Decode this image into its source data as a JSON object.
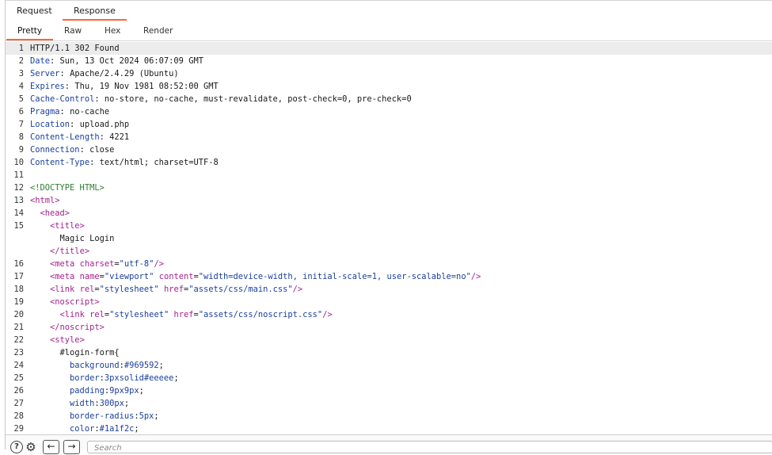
{
  "tabs": [
    {
      "label": "Request",
      "active": false
    },
    {
      "label": "Response",
      "active": true
    }
  ],
  "view_tabs": [
    {
      "label": "Pretty",
      "active": true
    },
    {
      "label": "Raw",
      "active": false
    },
    {
      "label": "Hex",
      "active": false
    },
    {
      "label": "Render",
      "active": false
    }
  ],
  "response_lines": [
    {
      "n": "1",
      "text": "HTTP/1.1 302 Found"
    },
    {
      "n": "2",
      "name": "Date",
      "value": "Sun, 13 Oct 2024 06:07:09 GMT"
    },
    {
      "n": "3",
      "name": "Server",
      "value": "Apache/2.4.29 (Ubuntu)"
    },
    {
      "n": "4",
      "name": "Expires",
      "value": "Thu, 19 Nov 1981 08:52:00 GMT"
    },
    {
      "n": "5",
      "name": "Cache-Control",
      "value": "no-store, no-cache, must-revalidate, post-check=0, pre-check=0"
    },
    {
      "n": "6",
      "name": "Pragma",
      "value": "no-cache"
    },
    {
      "n": "7",
      "name": "Location",
      "value": "upload.php"
    },
    {
      "n": "8",
      "name": "Content-Length",
      "value": "4221"
    },
    {
      "n": "9",
      "name": "Connection",
      "value": "close"
    },
    {
      "n": "10",
      "name": "Content-Type",
      "value": "text/html; charset=UTF-8"
    },
    {
      "n": "11",
      "text": ""
    },
    {
      "n": "12",
      "doctype": "<!DOCTYPE HTML>"
    },
    {
      "n": "13",
      "indent": "",
      "tag_open": "<html>"
    },
    {
      "n": "14",
      "indent": "  ",
      "tag_open": "<head>"
    },
    {
      "n": "15",
      "indent": "    ",
      "tag_open": "<title>"
    },
    {
      "n": "",
      "indent": "      ",
      "text": "Magic Login"
    },
    {
      "n": "",
      "indent": "    ",
      "tag_open": "</title>"
    },
    {
      "n": "16",
      "indent": "    ",
      "tag_name": "<meta",
      "attrs": [
        {
          "name": "charset",
          "value": "\"utf-8\""
        }
      ],
      "tag_end": "/>"
    },
    {
      "n": "17",
      "indent": "    ",
      "tag_name": "<meta",
      "attrs": [
        {
          "name": "name",
          "value": "\"viewport\""
        },
        {
          "name": "content",
          "value": "\"width=device-width, initial-scale=1, user-scalable=no\""
        }
      ],
      "tag_end": "/>"
    },
    {
      "n": "18",
      "indent": "    ",
      "tag_name": "<link",
      "attrs": [
        {
          "name": "rel",
          "value": "\"stylesheet\""
        },
        {
          "name": "href",
          "value": "\"assets/css/main.css\""
        }
      ],
      "tag_end": "/>"
    },
    {
      "n": "19",
      "indent": "    ",
      "tag_open": "<noscript>"
    },
    {
      "n": "20",
      "indent": "      ",
      "tag_name": "<link",
      "attrs": [
        {
          "name": "rel",
          "value": "\"stylesheet\""
        },
        {
          "name": "href",
          "value": "\"assets/css/noscript.css\""
        }
      ],
      "tag_end": "/>"
    },
    {
      "n": "21",
      "indent": "    ",
      "tag_open": "</noscript>"
    },
    {
      "n": "22",
      "indent": "    ",
      "tag_open": "<style>"
    },
    {
      "n": "23",
      "indent": "      ",
      "text": "#login-form{"
    },
    {
      "n": "24",
      "indent": "        ",
      "prop": "background",
      "pval": "#969592"
    },
    {
      "n": "25",
      "indent": "        ",
      "prop": "border",
      "pval": "3pxsolid#eeeee"
    },
    {
      "n": "26",
      "indent": "        ",
      "prop": "padding",
      "pval": "9px9px"
    },
    {
      "n": "27",
      "indent": "        ",
      "prop": "width",
      "pval": "300px"
    },
    {
      "n": "28",
      "indent": "        ",
      "prop": "border-radius",
      "pval": "5px"
    },
    {
      "n": "29",
      "indent": "        ",
      "prop": "color",
      "pval": "#1a1f2c"
    }
  ],
  "footer": {
    "search_placeholder": "Search",
    "back_glyph": "←",
    "forward_glyph": "→",
    "help_glyph": "?",
    "gear_glyph": "⚙"
  },
  "colors": {
    "accent": "#ff6633",
    "header_name": "#1a3f9c",
    "tag": "#a3228e",
    "doctype": "#2e7d32"
  }
}
